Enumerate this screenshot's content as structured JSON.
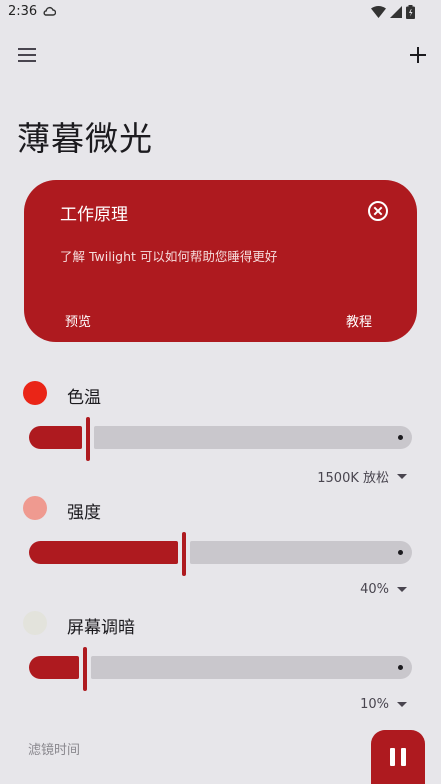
{
  "status_bar": {
    "time": "2:36"
  },
  "header": {
    "title": "薄暮微光"
  },
  "info_card": {
    "title": "工作原理",
    "description": "了解 Twilight 可以如何帮助您睡得更好",
    "left_button": "预览",
    "right_button": "教程",
    "color": "#ae1a1f"
  },
  "sections": [
    {
      "label": "色温",
      "dot_color": "#ea2517",
      "value": "1500K 放松",
      "slider_fraction": 0.15
    },
    {
      "label": "强度",
      "dot_color": "#ef9a90",
      "value": "40%",
      "slider_fraction": 0.4
    },
    {
      "label": "屏幕调暗",
      "dot_color": "#e3e3dc",
      "value": "10%",
      "slider_fraction": 0.14
    }
  ],
  "footer": {
    "label": "滤镜时间"
  }
}
